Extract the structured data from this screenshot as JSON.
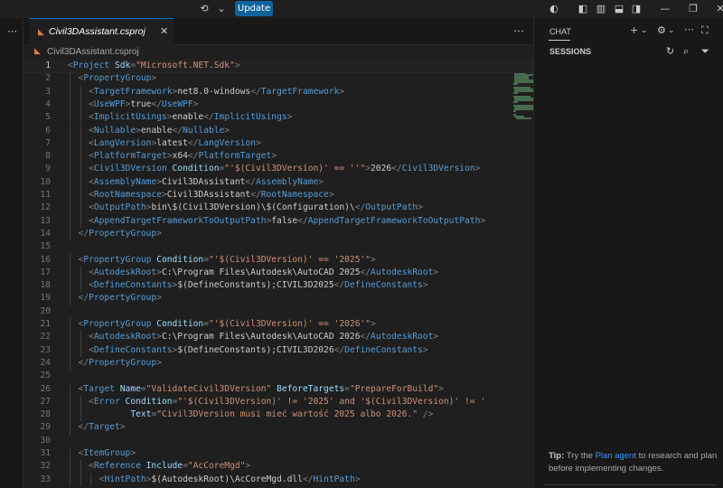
{
  "titlebar": {
    "update_label": "Update",
    "icons": [
      "copilot-icon",
      "chevron-down-icon",
      "accounts-icon",
      "layout-sidebar-left-icon",
      "layout-panel-icon",
      "layout-sidebar-right-icon",
      "restore-window-icon",
      "close-window-icon"
    ]
  },
  "editor": {
    "tab_label": "Civil3DAssistant.csproj",
    "breadcrumb_label": "Civil3DAssistant.csproj",
    "current_line": 1,
    "lines": [
      {
        "n": "1",
        "indent": 0,
        "tokens": [
          [
            "b",
            "<"
          ],
          [
            "g",
            "Project "
          ],
          [
            "a",
            "Sdk"
          ],
          [
            "b",
            "="
          ],
          [
            "s",
            "\"Microsoft.NET.Sdk\""
          ],
          [
            "b",
            ">"
          ]
        ]
      },
      {
        "n": "2",
        "indent": 1,
        "tokens": [
          [
            "b",
            "<"
          ],
          [
            "g",
            "PropertyGroup"
          ],
          [
            "b",
            ">"
          ]
        ]
      },
      {
        "n": "3",
        "indent": 2,
        "tokens": [
          [
            "b",
            "<"
          ],
          [
            "g",
            "TargetFramework"
          ],
          [
            "b",
            ">"
          ],
          [
            "t",
            "net8.0-windows"
          ],
          [
            "b",
            "</"
          ],
          [
            "g",
            "TargetFramework"
          ],
          [
            "b",
            ">"
          ]
        ]
      },
      {
        "n": "4",
        "indent": 2,
        "tokens": [
          [
            "b",
            "<"
          ],
          [
            "g",
            "UseWPF"
          ],
          [
            "b",
            ">"
          ],
          [
            "t",
            "true"
          ],
          [
            "b",
            "</"
          ],
          [
            "g",
            "UseWPF"
          ],
          [
            "b",
            ">"
          ]
        ]
      },
      {
        "n": "5",
        "indent": 2,
        "tokens": [
          [
            "b",
            "<"
          ],
          [
            "g",
            "ImplicitUsings"
          ],
          [
            "b",
            ">"
          ],
          [
            "t",
            "enable"
          ],
          [
            "b",
            "</"
          ],
          [
            "g",
            "ImplicitUsings"
          ],
          [
            "b",
            ">"
          ]
        ]
      },
      {
        "n": "6",
        "indent": 2,
        "tokens": [
          [
            "b",
            "<"
          ],
          [
            "g",
            "Nullable"
          ],
          [
            "b",
            ">"
          ],
          [
            "t",
            "enable"
          ],
          [
            "b",
            "</"
          ],
          [
            "g",
            "Nullable"
          ],
          [
            "b",
            ">"
          ]
        ]
      },
      {
        "n": "7",
        "indent": 2,
        "tokens": [
          [
            "b",
            "<"
          ],
          [
            "g",
            "LangVersion"
          ],
          [
            "b",
            ">"
          ],
          [
            "t",
            "latest"
          ],
          [
            "b",
            "</"
          ],
          [
            "g",
            "LangVersion"
          ],
          [
            "b",
            ">"
          ]
        ]
      },
      {
        "n": "8",
        "indent": 2,
        "tokens": [
          [
            "b",
            "<"
          ],
          [
            "g",
            "PlatformTarget"
          ],
          [
            "b",
            ">"
          ],
          [
            "t",
            "x64"
          ],
          [
            "b",
            "</"
          ],
          [
            "g",
            "PlatformTarget"
          ],
          [
            "b",
            ">"
          ]
        ]
      },
      {
        "n": "9",
        "indent": 2,
        "tokens": [
          [
            "b",
            "<"
          ],
          [
            "g",
            "Civil3DVersion "
          ],
          [
            "a",
            "Condition"
          ],
          [
            "b",
            "="
          ],
          [
            "s",
            "\"'$(Civil3DVersion)' == ''\""
          ],
          [
            "b",
            ">"
          ],
          [
            "t",
            "2026"
          ],
          [
            "b",
            "</"
          ],
          [
            "g",
            "Civil3DVersion"
          ],
          [
            "b",
            ">"
          ]
        ]
      },
      {
        "n": "10",
        "indent": 2,
        "tokens": [
          [
            "b",
            "<"
          ],
          [
            "g",
            "AssemblyName"
          ],
          [
            "b",
            ">"
          ],
          [
            "t",
            "Civil3DAssistant"
          ],
          [
            "b",
            "</"
          ],
          [
            "g",
            "AssemblyName"
          ],
          [
            "b",
            ">"
          ]
        ]
      },
      {
        "n": "11",
        "indent": 2,
        "tokens": [
          [
            "b",
            "<"
          ],
          [
            "g",
            "RootNamespace"
          ],
          [
            "b",
            ">"
          ],
          [
            "t",
            "Civil3DAssistant"
          ],
          [
            "b",
            "</"
          ],
          [
            "g",
            "RootNamespace"
          ],
          [
            "b",
            ">"
          ]
        ]
      },
      {
        "n": "12",
        "indent": 2,
        "tokens": [
          [
            "b",
            "<"
          ],
          [
            "g",
            "OutputPath"
          ],
          [
            "b",
            ">"
          ],
          [
            "t",
            "bin\\$(Civil3DVersion)\\$(Configuration)\\"
          ],
          [
            "b",
            "</"
          ],
          [
            "g",
            "OutputPath"
          ],
          [
            "b",
            ">"
          ]
        ]
      },
      {
        "n": "13",
        "indent": 2,
        "tokens": [
          [
            "b",
            "<"
          ],
          [
            "g",
            "AppendTargetFrameworkToOutputPath"
          ],
          [
            "b",
            ">"
          ],
          [
            "t",
            "false"
          ],
          [
            "b",
            "</"
          ],
          [
            "g",
            "AppendTargetFrameworkToOutputPath"
          ],
          [
            "b",
            ">"
          ]
        ]
      },
      {
        "n": "14",
        "indent": 1,
        "tokens": [
          [
            "b",
            "</"
          ],
          [
            "g",
            "PropertyGroup"
          ],
          [
            "b",
            ">"
          ]
        ]
      },
      {
        "n": "15",
        "indent": 0,
        "tokens": []
      },
      {
        "n": "16",
        "indent": 1,
        "tokens": [
          [
            "b",
            "<"
          ],
          [
            "g",
            "PropertyGroup "
          ],
          [
            "a",
            "Condition"
          ],
          [
            "b",
            "="
          ],
          [
            "s",
            "\"'$(Civil3DVersion)' == '2025'\""
          ],
          [
            "b",
            ">"
          ]
        ]
      },
      {
        "n": "17",
        "indent": 2,
        "tokens": [
          [
            "b",
            "<"
          ],
          [
            "g",
            "AutodeskRoot"
          ],
          [
            "b",
            ">"
          ],
          [
            "t",
            "C:\\Program Files\\Autodesk\\AutoCAD 2025"
          ],
          [
            "b",
            "</"
          ],
          [
            "g",
            "AutodeskRoot"
          ],
          [
            "b",
            ">"
          ]
        ]
      },
      {
        "n": "18",
        "indent": 2,
        "tokens": [
          [
            "b",
            "<"
          ],
          [
            "g",
            "DefineConstants"
          ],
          [
            "b",
            ">"
          ],
          [
            "t",
            "$(DefineConstants);CIVIL3D2025"
          ],
          [
            "b",
            "</"
          ],
          [
            "g",
            "DefineConstants"
          ],
          [
            "b",
            ">"
          ]
        ]
      },
      {
        "n": "19",
        "indent": 1,
        "tokens": [
          [
            "b",
            "</"
          ],
          [
            "g",
            "PropertyGroup"
          ],
          [
            "b",
            ">"
          ]
        ]
      },
      {
        "n": "20",
        "indent": 0,
        "tokens": []
      },
      {
        "n": "21",
        "indent": 1,
        "tokens": [
          [
            "b",
            "<"
          ],
          [
            "g",
            "PropertyGroup "
          ],
          [
            "a",
            "Condition"
          ],
          [
            "b",
            "="
          ],
          [
            "s",
            "\"'$(Civil3DVersion)' == '2026'\""
          ],
          [
            "b",
            ">"
          ]
        ]
      },
      {
        "n": "22",
        "indent": 2,
        "tokens": [
          [
            "b",
            "<"
          ],
          [
            "g",
            "AutodeskRoot"
          ],
          [
            "b",
            ">"
          ],
          [
            "t",
            "C:\\Program Files\\Autodesk\\AutoCAD 2026"
          ],
          [
            "b",
            "</"
          ],
          [
            "g",
            "AutodeskRoot"
          ],
          [
            "b",
            ">"
          ]
        ]
      },
      {
        "n": "23",
        "indent": 2,
        "tokens": [
          [
            "b",
            "<"
          ],
          [
            "g",
            "DefineConstants"
          ],
          [
            "b",
            ">"
          ],
          [
            "t",
            "$(DefineConstants);CIVIL3D2026"
          ],
          [
            "b",
            "</"
          ],
          [
            "g",
            "DefineConstants"
          ],
          [
            "b",
            ">"
          ]
        ]
      },
      {
        "n": "24",
        "indent": 1,
        "tokens": [
          [
            "b",
            "</"
          ],
          [
            "g",
            "PropertyGroup"
          ],
          [
            "b",
            ">"
          ]
        ]
      },
      {
        "n": "25",
        "indent": 0,
        "tokens": []
      },
      {
        "n": "26",
        "indent": 1,
        "tokens": [
          [
            "b",
            "<"
          ],
          [
            "g",
            "Target "
          ],
          [
            "a",
            "Name"
          ],
          [
            "b",
            "="
          ],
          [
            "s",
            "\"ValidateCivil3DVersion\""
          ],
          [
            "t",
            " "
          ],
          [
            "a",
            "BeforeTargets"
          ],
          [
            "b",
            "="
          ],
          [
            "s",
            "\"PrepareForBuild\""
          ],
          [
            "b",
            ">"
          ]
        ]
      },
      {
        "n": "27",
        "indent": 2,
        "tokens": [
          [
            "b",
            "<"
          ],
          [
            "g",
            "Error "
          ],
          [
            "a",
            "Condition"
          ],
          [
            "b",
            "="
          ],
          [
            "s",
            "\"'$(Civil3DVersion)' != '2025' and '$(Civil3DVersion)' != '"
          ]
        ]
      },
      {
        "n": "28",
        "indent": 2,
        "tokens": [
          [
            "t",
            "        "
          ],
          [
            "a",
            "Text"
          ],
          [
            "b",
            "="
          ],
          [
            "s",
            "\"Civil3DVersion musi mieć wartość 2025 albo 2026.\""
          ],
          [
            "t",
            " "
          ],
          [
            "b",
            "/>"
          ]
        ]
      },
      {
        "n": "29",
        "indent": 1,
        "tokens": [
          [
            "b",
            "</"
          ],
          [
            "g",
            "Target"
          ],
          [
            "b",
            ">"
          ]
        ]
      },
      {
        "n": "30",
        "indent": 0,
        "tokens": []
      },
      {
        "n": "31",
        "indent": 1,
        "tokens": [
          [
            "b",
            "<"
          ],
          [
            "g",
            "ItemGroup"
          ],
          [
            "b",
            ">"
          ]
        ]
      },
      {
        "n": "32",
        "indent": 2,
        "tokens": [
          [
            "b",
            "<"
          ],
          [
            "g",
            "Reference "
          ],
          [
            "a",
            "Include"
          ],
          [
            "b",
            "="
          ],
          [
            "s",
            "\"AcCoreMgd\""
          ],
          [
            "b",
            ">"
          ]
        ]
      },
      {
        "n": "33",
        "indent": 3,
        "tokens": [
          [
            "b",
            "<"
          ],
          [
            "g",
            "HintPath"
          ],
          [
            "b",
            ">"
          ],
          [
            "t",
            "$(AutodeskRoot)\\AcCoreMgd.dll"
          ],
          [
            "b",
            "</"
          ],
          [
            "g",
            "HintPath"
          ],
          [
            "b",
            ">"
          ]
        ]
      }
    ]
  },
  "chat": {
    "title": "CHAT",
    "sessions_label": "SESSIONS",
    "tip_bold": "Tip:",
    "tip_pre": " Try the ",
    "tip_link": "Plan agent",
    "tip_post": " to research and plan before implementing changes."
  },
  "colors": {
    "accent": "#0e639c",
    "tag": "#569cd6",
    "attribute": "#9cdcfe",
    "string": "#ce9178",
    "link": "#3794ff"
  }
}
